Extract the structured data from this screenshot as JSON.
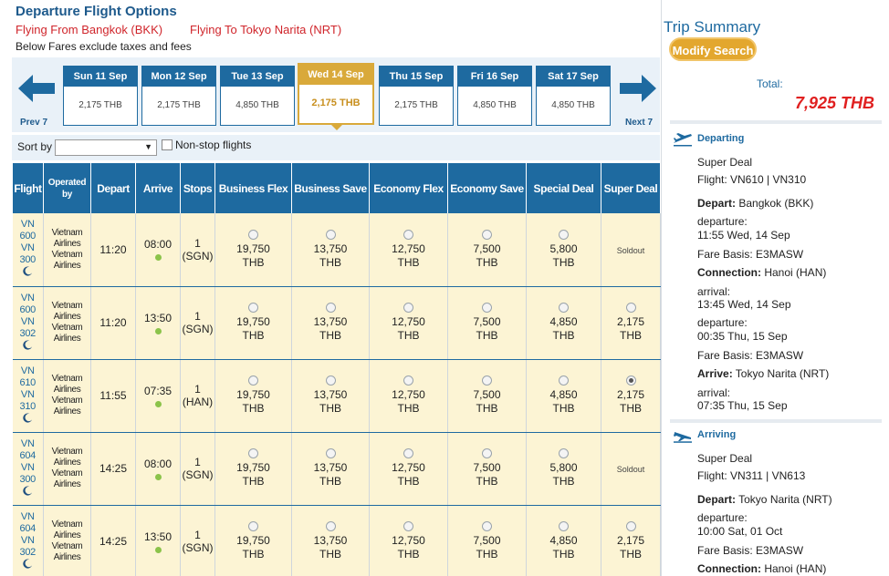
{
  "header": {
    "title": "Departure Flight Options",
    "from": "Flying From Bangkok (BKK)",
    "to": "Flying To Tokyo Narita (NRT)",
    "fare_note": "Below Fares exclude taxes and fees"
  },
  "date_nav": {
    "prev_label": "Prev 7",
    "next_label": "Next 7",
    "dates": [
      {
        "label": "Sun 11 Sep",
        "price": "2,175 THB",
        "selected": false
      },
      {
        "label": "Mon 12 Sep",
        "price": "2,175 THB",
        "selected": false
      },
      {
        "label": "Tue 13 Sep",
        "price": "4,850 THB",
        "selected": false
      },
      {
        "label": "Wed 14 Sep",
        "price": "2,175 THB",
        "selected": true
      },
      {
        "label": "Thu 15 Sep",
        "price": "2,175 THB",
        "selected": false
      },
      {
        "label": "Fri 16 Sep",
        "price": "4,850 THB",
        "selected": false
      },
      {
        "label": "Sat 17 Sep",
        "price": "4,850 THB",
        "selected": false
      }
    ]
  },
  "sort": {
    "label": "Sort by",
    "value": "",
    "nonstop_label": "Non-stop flights",
    "nonstop_checked": false
  },
  "table": {
    "headers": {
      "flight": "Flight",
      "operated": "Operated by",
      "depart": "Depart",
      "arrive": "Arrive",
      "stops": "Stops",
      "fares": [
        "Business Flex",
        "Business Save",
        "Economy Flex",
        "Economy Save",
        "Special Deal",
        "Super Deal"
      ]
    },
    "rows": [
      {
        "flight": [
          "VN",
          "600",
          "VN",
          "300"
        ],
        "operated": [
          "Vietnam",
          "Airlines",
          "Vietnam",
          "Airlines"
        ],
        "depart": "11:20",
        "arrive": "08:00",
        "stops": "1",
        "via": "(SGN)",
        "fares": [
          {
            "amount": "19,750",
            "cur": "THB"
          },
          {
            "amount": "13,750",
            "cur": "THB"
          },
          {
            "amount": "12,750",
            "cur": "THB"
          },
          {
            "amount": "7,500",
            "cur": "THB"
          },
          {
            "amount": "5,800",
            "cur": "THB"
          },
          {
            "soldout": "Soldout"
          }
        ]
      },
      {
        "flight": [
          "VN",
          "600",
          "VN",
          "302"
        ],
        "operated": [
          "Vietnam",
          "Airlines",
          "Vietnam",
          "Airlines"
        ],
        "depart": "11:20",
        "arrive": "13:50",
        "stops": "1",
        "via": "(SGN)",
        "fares": [
          {
            "amount": "19,750",
            "cur": "THB"
          },
          {
            "amount": "13,750",
            "cur": "THB"
          },
          {
            "amount": "12,750",
            "cur": "THB"
          },
          {
            "amount": "7,500",
            "cur": "THB"
          },
          {
            "amount": "4,850",
            "cur": "THB"
          },
          {
            "amount": "2,175",
            "cur": "THB"
          }
        ]
      },
      {
        "flight": [
          "VN",
          "610",
          "VN",
          "310"
        ],
        "operated": [
          "Vietnam",
          "Airlines",
          "Vietnam",
          "Airlines"
        ],
        "depart": "11:55",
        "arrive": "07:35",
        "stops": "1",
        "via": "(HAN)",
        "fares": [
          {
            "amount": "19,750",
            "cur": "THB"
          },
          {
            "amount": "13,750",
            "cur": "THB"
          },
          {
            "amount": "12,750",
            "cur": "THB"
          },
          {
            "amount": "7,500",
            "cur": "THB"
          },
          {
            "amount": "4,850",
            "cur": "THB"
          },
          {
            "amount": "2,175",
            "cur": "THB",
            "checked": true
          }
        ]
      },
      {
        "flight": [
          "VN",
          "604",
          "VN",
          "300"
        ],
        "operated": [
          "Vietnam",
          "Airlines",
          "Vietnam",
          "Airlines"
        ],
        "depart": "14:25",
        "arrive": "08:00",
        "stops": "1",
        "via": "(SGN)",
        "fares": [
          {
            "amount": "19,750",
            "cur": "THB"
          },
          {
            "amount": "13,750",
            "cur": "THB"
          },
          {
            "amount": "12,750",
            "cur": "THB"
          },
          {
            "amount": "7,500",
            "cur": "THB"
          },
          {
            "amount": "5,800",
            "cur": "THB"
          },
          {
            "soldout": "Soldout"
          }
        ]
      },
      {
        "flight": [
          "VN",
          "604",
          "VN",
          "302"
        ],
        "operated": [
          "Vietnam",
          "Airlines",
          "Vietnam",
          "Airlines"
        ],
        "depart": "14:25",
        "arrive": "13:50",
        "stops": "1",
        "via": "(SGN)",
        "fares": [
          {
            "amount": "19,750",
            "cur": "THB"
          },
          {
            "amount": "13,750",
            "cur": "THB"
          },
          {
            "amount": "12,750",
            "cur": "THB"
          },
          {
            "amount": "7,500",
            "cur": "THB"
          },
          {
            "amount": "4,850",
            "cur": "THB"
          },
          {
            "amount": "2,175",
            "cur": "THB"
          }
        ]
      }
    ]
  },
  "summary": {
    "title": "Trip Summary",
    "modify_label": "Modify Search",
    "total_label": "Total:",
    "total_value": "7,925 THB",
    "departing": {
      "title": "Departing",
      "fare_name": "Super Deal",
      "flight": "Flight: VN610 | VN310",
      "depart_label": "Depart:",
      "depart_value": " Bangkok (BKK)",
      "departure_label": "departure:",
      "departure_time": "11:55 Wed, 14 Sep",
      "fare_basis_1": "Fare Basis: E3MASW",
      "connection_label": "Connection:",
      "connection_value": " Hanoi (HAN)",
      "arrival_label_1": "arrival:",
      "arrival_time_1": "13:45 Wed, 14 Sep",
      "departure_label_2": "departure:",
      "departure_time_2": "00:35 Thu, 15 Sep",
      "fare_basis_2": "Fare Basis: E3MASW",
      "arrive_label": "Arrive:",
      "arrive_value": " Tokyo Narita (NRT)",
      "arrival_label_2": "arrival:",
      "arrival_time_2": "07:35 Thu, 15 Sep"
    },
    "arriving": {
      "title": "Arriving",
      "fare_name": "Super Deal",
      "flight": "Flight: VN311 | VN613",
      "depart_label": "Depart:",
      "depart_value": " Tokyo Narita (NRT)",
      "departure_label": "departure:",
      "departure_time": "10:00 Sat, 01 Oct",
      "fare_basis": "Fare Basis: E3MASW",
      "connection_label": "Connection:",
      "connection_value": " Hanoi (HAN)"
    }
  },
  "colors": {
    "primary_blue": "#1e6aa0",
    "selected_gold": "#d9a93a",
    "row_bg": "#fcf4d4",
    "total_red": "#e02020",
    "route_red": "#d0252b"
  },
  "icons": {
    "prev": "arrow-left-icon",
    "next": "arrow-right-icon",
    "night": "moon-icon",
    "status": "green-dot-icon",
    "departing": "plane-takeoff-icon",
    "arriving": "plane-landing-icon"
  }
}
